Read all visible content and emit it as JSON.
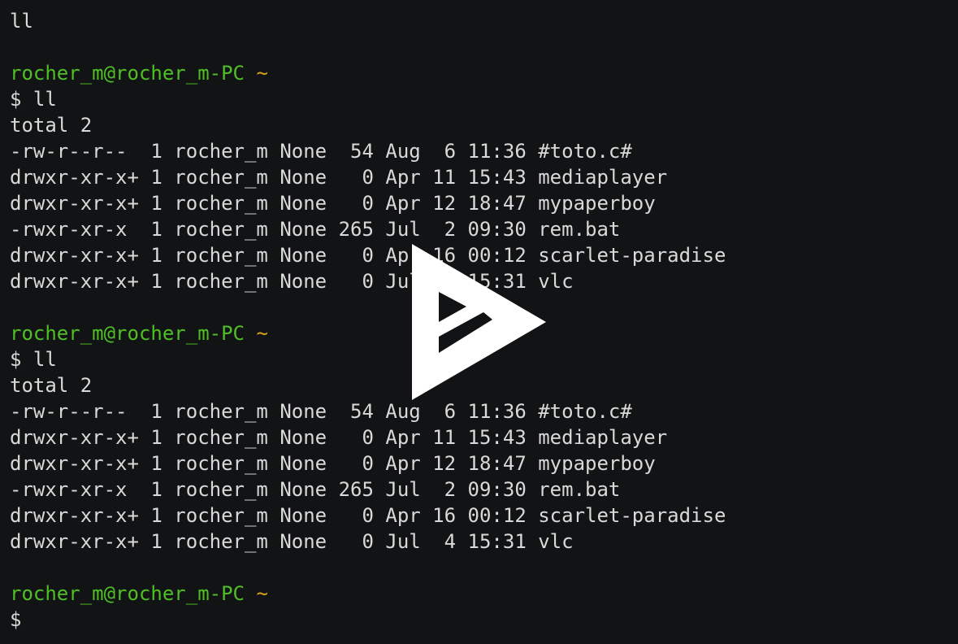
{
  "terminal": {
    "lines": [
      {
        "type": "output",
        "text": "ll"
      },
      {
        "type": "blank",
        "text": ""
      },
      {
        "type": "prompt",
        "user": "rocher_m@rocher_m-PC",
        "dir": "~"
      },
      {
        "type": "command",
        "text": "$ ll"
      },
      {
        "type": "output",
        "text": "total 2"
      },
      {
        "type": "output",
        "text": "-rw-r--r--  1 rocher_m None  54 Aug  6 11:36 #toto.c#"
      },
      {
        "type": "output",
        "text": "drwxr-xr-x+ 1 rocher_m None   0 Apr 11 15:43 mediaplayer"
      },
      {
        "type": "output",
        "text": "drwxr-xr-x+ 1 rocher_m None   0 Apr 12 18:47 mypaperboy"
      },
      {
        "type": "output",
        "text": "-rwxr-xr-x  1 rocher_m None 265 Jul  2 09:30 rem.bat"
      },
      {
        "type": "output",
        "text": "drwxr-xr-x+ 1 rocher_m None   0 Apr 16 00:12 scarlet-paradise"
      },
      {
        "type": "output",
        "text": "drwxr-xr-x+ 1 rocher_m None   0 Jul  4 15:31 vlc"
      },
      {
        "type": "blank",
        "text": ""
      },
      {
        "type": "prompt",
        "user": "rocher_m@rocher_m-PC",
        "dir": "~"
      },
      {
        "type": "command",
        "text": "$ ll"
      },
      {
        "type": "output",
        "text": "total 2"
      },
      {
        "type": "output",
        "text": "-rw-r--r--  1 rocher_m None  54 Aug  6 11:36 #toto.c#"
      },
      {
        "type": "output",
        "text": "drwxr-xr-x+ 1 rocher_m None   0 Apr 11 15:43 mediaplayer"
      },
      {
        "type": "output",
        "text": "drwxr-xr-x+ 1 rocher_m None   0 Apr 12 18:47 mypaperboy"
      },
      {
        "type": "output",
        "text": "-rwxr-xr-x  1 rocher_m None 265 Jul  2 09:30 rem.bat"
      },
      {
        "type": "output",
        "text": "drwxr-xr-x+ 1 rocher_m None   0 Apr 16 00:12 scarlet-paradise"
      },
      {
        "type": "output",
        "text": "drwxr-xr-x+ 1 rocher_m None   0 Jul  4 15:31 vlc"
      },
      {
        "type": "blank",
        "text": ""
      },
      {
        "type": "prompt",
        "user": "rocher_m@rocher_m-PC",
        "dir": "~"
      },
      {
        "type": "command",
        "text": "$"
      }
    ]
  },
  "overlay": {
    "icon": "asciinema-play-icon"
  },
  "colors": {
    "background": "#121314",
    "text": "#d9d9d9",
    "prompt_user": "#4fbf26",
    "prompt_dir": "#d6a41a",
    "overlay_icon": "#ffffff"
  }
}
